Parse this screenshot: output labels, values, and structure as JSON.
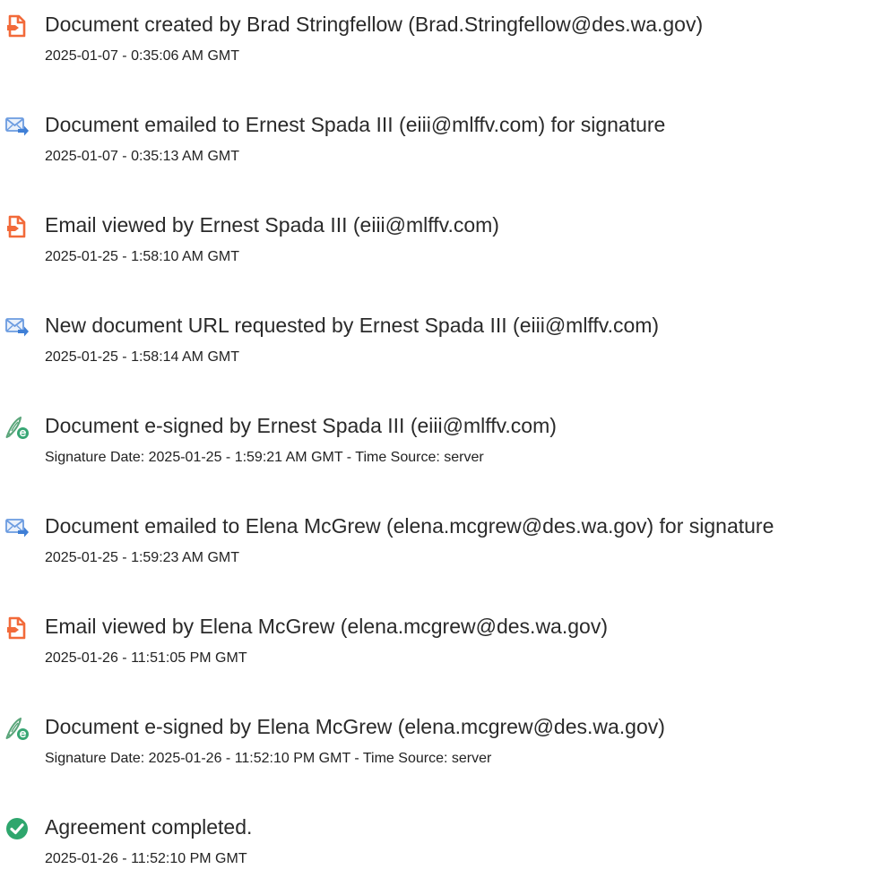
{
  "colors": {
    "doc_icon": "#f26a3a",
    "mail_icon": "#5b8fd8",
    "sign_icon": "#3aa776",
    "complete_icon": "#2ea66d"
  },
  "events": [
    {
      "icon": "document-icon",
      "title": "Document created by Brad Stringfellow (Brad.Stringfellow@des.wa.gov)",
      "detail": "2025-01-07 - 0:35:06 AM GMT"
    },
    {
      "icon": "email-icon",
      "title": "Document emailed to Ernest Spada III (eiii@mlffv.com) for signature",
      "detail": "2025-01-07 - 0:35:13 AM GMT"
    },
    {
      "icon": "document-icon",
      "title": "Email viewed by Ernest Spada III (eiii@mlffv.com)",
      "detail": "2025-01-25 - 1:58:10 AM GMT"
    },
    {
      "icon": "email-icon",
      "title": "New document URL requested by Ernest Spada III (eiii@mlffv.com)",
      "detail": "2025-01-25 - 1:58:14 AM GMT"
    },
    {
      "icon": "esign-pen-icon",
      "title": "Document e-signed by Ernest Spada III (eiii@mlffv.com)",
      "detail": "Signature Date: 2025-01-25 - 1:59:21 AM GMT - Time Source: server"
    },
    {
      "icon": "email-icon",
      "title": "Document emailed to Elena McGrew (elena.mcgrew@des.wa.gov) for signature",
      "detail": "2025-01-25 - 1:59:23 AM GMT"
    },
    {
      "icon": "document-icon",
      "title": "Email viewed by Elena McGrew (elena.mcgrew@des.wa.gov)",
      "detail": "2025-01-26 - 11:51:05 PM GMT"
    },
    {
      "icon": "esign-pen-icon",
      "title": "Document e-signed by Elena McGrew (elena.mcgrew@des.wa.gov)",
      "detail": "Signature Date: 2025-01-26 - 11:52:10 PM GMT - Time Source: server"
    },
    {
      "icon": "checkmark-icon",
      "title": "Agreement completed.",
      "detail": "2025-01-26 - 11:52:10 PM GMT"
    }
  ]
}
